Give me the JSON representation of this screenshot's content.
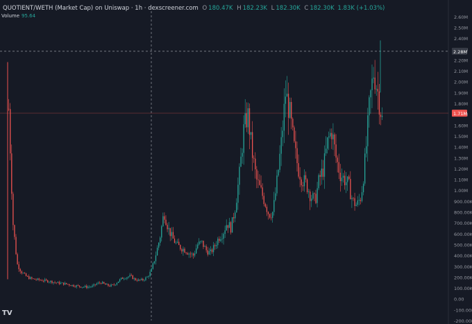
{
  "header": {
    "title": "QUOTIENT/WETH (Market Cap) on Uniswap · 1h · dexscreener.com",
    "ohlc": [
      {
        "label": "O",
        "value": "180.47K"
      },
      {
        "label": "H",
        "value": "182.23K"
      },
      {
        "label": "L",
        "value": "182.30K"
      },
      {
        "label": "C",
        "value": "182.30K"
      }
    ],
    "change": "1.83K (+1.03%)"
  },
  "volume": {
    "label": "Volume",
    "value": "95.64"
  },
  "logo_text": "TV",
  "colors": {
    "background": "#161a25",
    "up": "#26a69a",
    "down": "#ef5350",
    "text": "#9598a1",
    "crosshair": "#9598a1"
  },
  "chart_data": {
    "type": "candlestick",
    "title": "QUOTIENT/WETH (Market Cap)",
    "ylabel": "",
    "xlabel": "",
    "ylim": [
      -200000,
      2650000
    ],
    "y_ticks": [
      "2.60M",
      "2.50M",
      "2.40M",
      "2.30M",
      "2.20M",
      "2.10M",
      "2.00M",
      "1.90M",
      "1.80M",
      "1.70M",
      "1.60M",
      "1.50M",
      "1.40M",
      "1.30M",
      "1.20M",
      "1.10M",
      "1.00M",
      "900.00K",
      "800.00K",
      "700.00K",
      "600.00K",
      "500.00K",
      "400.00K",
      "300.00K",
      "200.00K",
      "100.00K",
      "0.00",
      "-100.00K",
      "-200.00K"
    ],
    "y_tick_values": [
      2600000,
      2500000,
      2400000,
      2300000,
      2200000,
      2100000,
      2000000,
      1900000,
      1800000,
      1700000,
      1600000,
      1500000,
      1400000,
      1300000,
      1200000,
      1100000,
      1000000,
      900000,
      800000,
      700000,
      600000,
      500000,
      400000,
      300000,
      200000,
      100000,
      0,
      -100000,
      -200000
    ],
    "crosshair_price": "2.28M",
    "crosshair_value": 2280000,
    "last_price": "1.71M",
    "last_value": 1710000,
    "close_series": [
      1750000,
      700000,
      320000,
      250000,
      210000,
      190000,
      180000,
      175000,
      170000,
      165000,
      160000,
      150000,
      145000,
      140000,
      135000,
      125000,
      120000,
      115000,
      110000,
      110000,
      115000,
      140000,
      150000,
      130000,
      120000,
      125000,
      160000,
      190000,
      200000,
      210000,
      180000,
      170000,
      175000,
      200000,
      260000,
      400000,
      560000,
      800000,
      650000,
      560000,
      500000,
      470000,
      450000,
      420000,
      400000,
      500000,
      520000,
      450000,
      420000,
      480000,
      560000,
      600000,
      700000,
      650000,
      850000,
      1150000,
      1550000,
      1700000,
      1350000,
      1100000,
      1000000,
      900000,
      780000,
      800000,
      1100000,
      1450000,
      1900000,
      1700000,
      1400000,
      1200000,
      1100000,
      1050000,
      950000,
      900000,
      1100000,
      1200000,
      1450000,
      1550000,
      1300000,
      1150000,
      1100000,
      1050000,
      900000,
      860000,
      950000,
      1300000,
      1800000,
      2100000,
      1900000,
      1650000
    ]
  }
}
